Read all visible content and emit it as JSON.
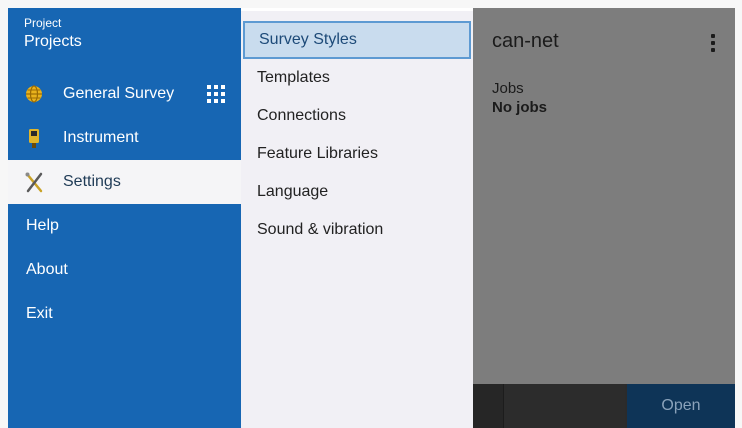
{
  "nav": {
    "header_small": "Project",
    "header_big": "Projects",
    "items": [
      {
        "label": "General Survey",
        "icon": "globe-icon"
      },
      {
        "label": "Instrument",
        "icon": "instrument-icon"
      },
      {
        "label": "Settings",
        "icon": "tools-icon",
        "selected": true
      },
      {
        "label": "Help"
      },
      {
        "label": "About"
      },
      {
        "label": "Exit"
      }
    ],
    "apps_icon": "grid-apps-icon"
  },
  "menu": {
    "items": [
      {
        "label": "Survey Styles",
        "active": true
      },
      {
        "label": "Templates"
      },
      {
        "label": "Connections"
      },
      {
        "label": "Feature Libraries"
      },
      {
        "label": "Language"
      },
      {
        "label": "Sound & vibration"
      }
    ]
  },
  "pane": {
    "title": "can-net",
    "jobs_label": "Jobs",
    "jobs_value": "No jobs",
    "open_label": "Open"
  },
  "colors": {
    "nav_bg": "#1766b3",
    "menu_bg": "#f1f0f5",
    "active_bg": "#c9dcee",
    "pane_dimmed": "#7d7d7d",
    "open_button": "#0e3457"
  }
}
